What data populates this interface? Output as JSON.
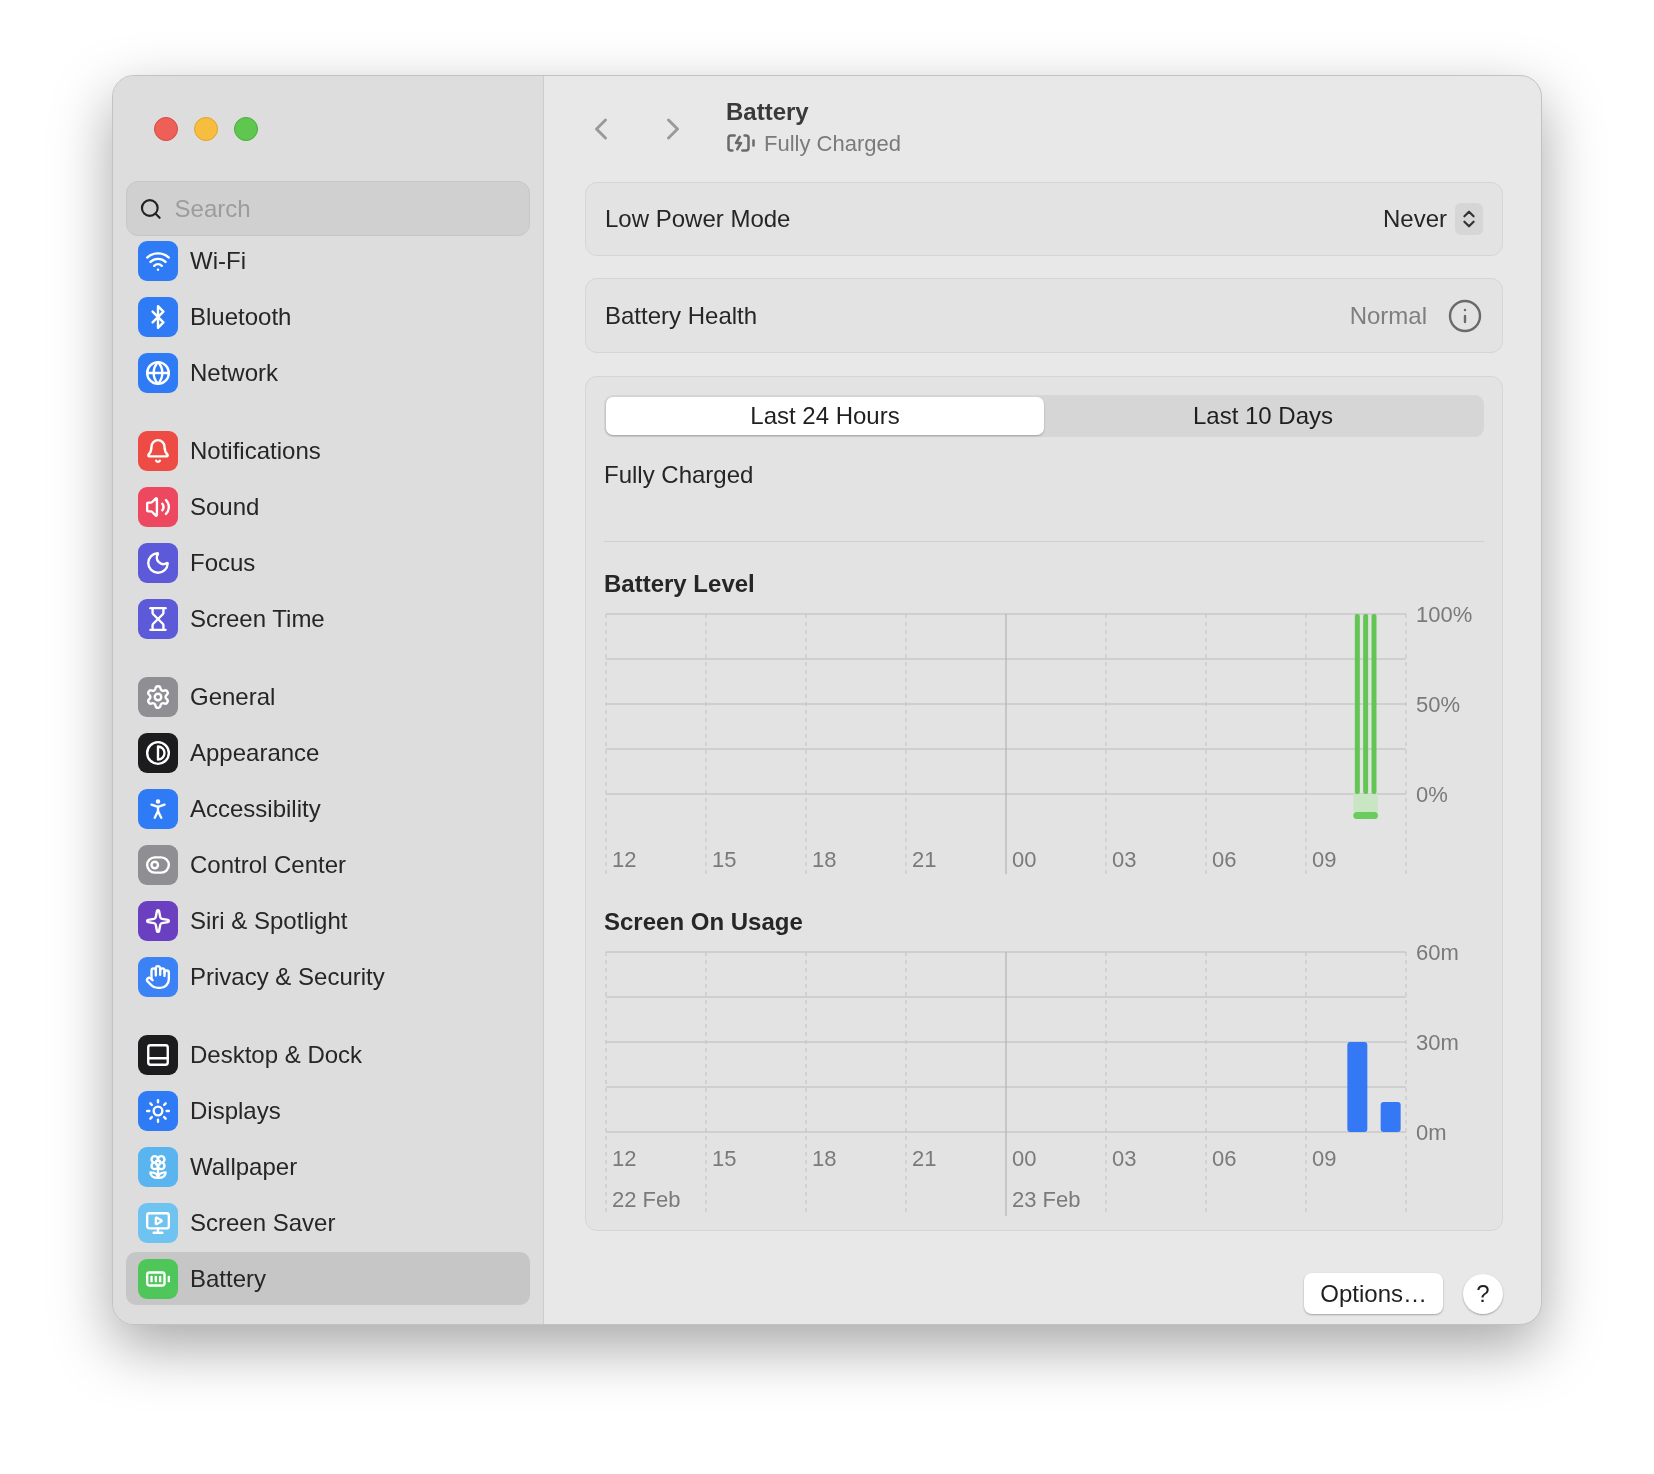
{
  "sidebar": {
    "search": {
      "placeholder": "Search"
    },
    "groups": [
      {
        "items": [
          {
            "label": "Wi-Fi",
            "color": "#2f7bf5",
            "selected": false
          },
          {
            "label": "Bluetooth",
            "color": "#2f7bf5",
            "selected": false
          },
          {
            "label": "Network",
            "color": "#2f7bf5",
            "selected": false
          }
        ]
      },
      {
        "items": [
          {
            "label": "Notifications",
            "color": "#ef4b45",
            "selected": false
          },
          {
            "label": "Sound",
            "color": "#ee4760",
            "selected": false
          },
          {
            "label": "Focus",
            "color": "#5c5ad8",
            "selected": false
          },
          {
            "label": "Screen Time",
            "color": "#5c5ad8",
            "selected": false
          }
        ]
      },
      {
        "items": [
          {
            "label": "General",
            "color": "#8e8e93",
            "selected": false
          },
          {
            "label": "Appearance",
            "color": "#1c1c1e",
            "selected": false
          },
          {
            "label": "Accessibility",
            "color": "#2f7bf5",
            "selected": false
          },
          {
            "label": "Control Center",
            "color": "#8e8e93",
            "selected": false
          },
          {
            "label": "Siri & Spotlight",
            "color": "#6a3fc0",
            "selected": false
          },
          {
            "label": "Privacy & Security",
            "color": "#3b82f6",
            "selected": false
          }
        ]
      },
      {
        "items": [
          {
            "label": "Desktop & Dock",
            "color": "#1c1c1e",
            "selected": false
          },
          {
            "label": "Displays",
            "color": "#2f7bf5",
            "selected": false
          },
          {
            "label": "Wallpaper",
            "color": "#5ab4ef",
            "selected": false
          },
          {
            "label": "Screen Saver",
            "color": "#6ec3f0",
            "selected": false
          },
          {
            "label": "Battery",
            "color": "#4fc65a",
            "selected": true
          }
        ]
      }
    ]
  },
  "header": {
    "title": "Battery",
    "subtitle": "Fully Charged"
  },
  "low_power_mode": {
    "label": "Low Power Mode",
    "value": "Never"
  },
  "battery_health": {
    "label": "Battery Health",
    "value": "Normal"
  },
  "usage": {
    "tabs": [
      {
        "label": "Last 24 Hours",
        "selected": true
      },
      {
        "label": "Last 10 Days",
        "selected": false
      }
    ],
    "status": "Fully Charged",
    "battery_level": {
      "chart_data": {
        "type": "bar",
        "title": "Battery Level",
        "categories": [
          "12",
          null,
          null,
          null,
          null,
          null,
          null,
          null,
          null,
          null,
          null,
          null,
          "15",
          null,
          null,
          null,
          null,
          null,
          null,
          null,
          null,
          null,
          null,
          null,
          "18",
          null,
          null,
          null,
          null,
          null,
          null,
          null,
          null,
          null,
          null,
          null,
          "21",
          null,
          null,
          null,
          null,
          null,
          null,
          null,
          null,
          null,
          null,
          null,
          "00",
          null,
          null,
          null,
          null,
          null,
          null,
          null,
          null,
          null,
          null,
          null,
          "03",
          null,
          null,
          null,
          null,
          null,
          null,
          null,
          null,
          null,
          null,
          null,
          "06",
          null,
          null,
          null,
          null,
          null,
          null,
          null,
          null,
          null,
          null,
          null,
          "09",
          null,
          null,
          null,
          null,
          null,
          null,
          null,
          null,
          null,
          null,
          null
        ],
        "series": [
          {
            "color": "#62c554",
            "values": [
              null,
              null,
              null,
              null,
              null,
              null,
              null,
              null,
              null,
              null,
              null,
              null,
              null,
              null,
              null,
              null,
              null,
              null,
              null,
              null,
              null,
              null,
              null,
              null,
              null,
              null,
              null,
              null,
              null,
              null,
              null,
              null,
              null,
              null,
              null,
              null,
              null,
              null,
              null,
              null,
              null,
              null,
              null,
              null,
              null,
              null,
              null,
              null,
              null,
              null,
              null,
              null,
              null,
              null,
              null,
              null,
              null,
              null,
              null,
              null,
              null,
              null,
              null,
              null,
              null,
              null,
              null,
              null,
              null,
              null,
              null,
              null,
              null,
              null,
              null,
              null,
              null,
              null,
              null,
              null,
              null,
              null,
              null,
              null,
              null,
              null,
              null,
              null,
              100,
              100,
              100,
              null,
              null,
              null,
              null,
              null
            ]
          }
        ],
        "ylim": [
          0,
          100
        ],
        "yticks": [
          {
            "value": 0,
            "label": "0%"
          },
          {
            "value": 50,
            "label": "50%"
          },
          {
            "value": 100,
            "label": "100%"
          }
        ]
      }
    },
    "screen_on_usage": {
      "chart_data": {
        "type": "bar",
        "title": "Screen On Usage",
        "categories": [
          "12",
          null,
          null,
          "15",
          null,
          null,
          "18",
          null,
          null,
          "21",
          null,
          null,
          "00",
          null,
          null,
          "03",
          null,
          null,
          "06",
          null,
          null,
          "09",
          null,
          null
        ],
        "series": [
          {
            "color": "#3478f6",
            "values": [
              null,
              null,
              null,
              null,
              null,
              null,
              null,
              null,
              null,
              null,
              null,
              null,
              null,
              null,
              null,
              null,
              null,
              null,
              null,
              null,
              null,
              null,
              30,
              10
            ]
          }
        ],
        "ylim": [
          0,
          60
        ],
        "yticks": [
          {
            "value": 0,
            "label": "0m"
          },
          {
            "value": 30,
            "label": "30m"
          },
          {
            "value": 60,
            "label": "60m"
          }
        ],
        "annotations": [
          "22 Feb",
          "23 Feb"
        ]
      }
    }
  },
  "footer": {
    "options_button": "Options…",
    "help_button": "?"
  }
}
